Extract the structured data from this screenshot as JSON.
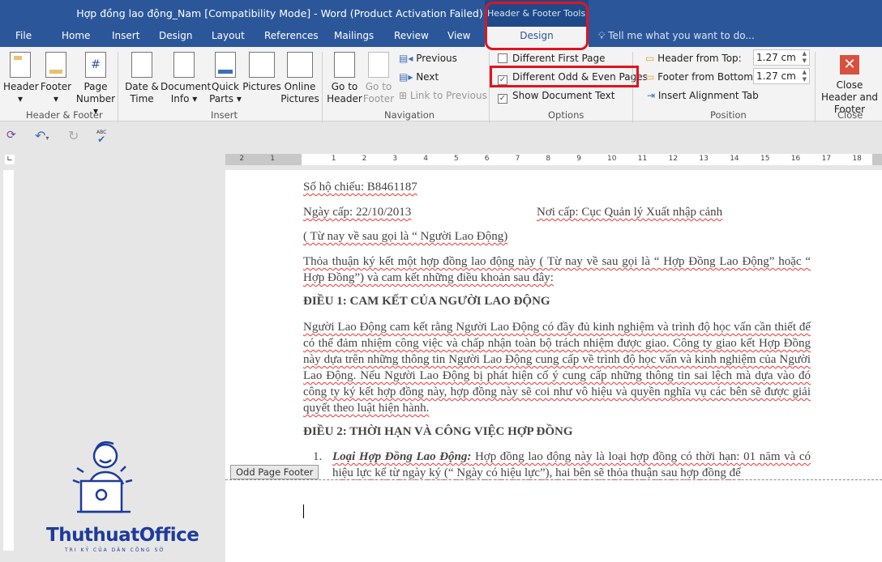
{
  "window": {
    "title": "Hợp đồng lao động_Nam [Compatibility Mode] - Word (Product Activation Failed)"
  },
  "tabs": [
    "File",
    "Home",
    "Insert",
    "Design",
    "Layout",
    "References",
    "Mailings",
    "Review",
    "View"
  ],
  "context_tab": {
    "group": "Header & Footer Tools",
    "label": "Design"
  },
  "tell_me": "Tell me what you want to do...",
  "ribbon": {
    "header_footer": {
      "label": "Header & Footer",
      "header": "Header",
      "footer": "Footer",
      "page_number": "Page Number"
    },
    "insert": {
      "label": "Insert",
      "date_time": "Date & Time",
      "doc_info": "Document Info",
      "quick_parts": "Quick Parts",
      "pictures": "Pictures",
      "online_pictures": "Online Pictures"
    },
    "navigation": {
      "label": "Navigation",
      "go_header": "Go to Header",
      "go_footer": "Go to Footer",
      "previous": "Previous",
      "next": "Next",
      "link_prev": "Link to Previous"
    },
    "options": {
      "label": "Options",
      "diff_first": "Different First Page",
      "diff_first_checked": false,
      "diff_odd_even": "Different Odd & Even Pages",
      "diff_odd_even_checked": true,
      "show_doc_text": "Show Document Text",
      "show_doc_text_checked": true
    },
    "position": {
      "label": "Position",
      "header_top": "Header from Top:",
      "header_top_value": "1.27 cm",
      "footer_bottom": "Footer from Bottom:",
      "footer_bottom_value": "1.27 cm",
      "align_tab": "Insert Alignment Tab"
    },
    "close": {
      "label": "Close",
      "close_btn": "Close Header and Footer"
    }
  },
  "ruler": {
    "labels": [
      "2",
      "1",
      "1",
      "2",
      "3",
      "4",
      "5",
      "6",
      "7",
      "8",
      "9",
      "10",
      "11",
      "12",
      "13",
      "14",
      "15",
      "16",
      "17",
      "18"
    ]
  },
  "document": {
    "passport": "Số hộ chiếu: B8461187",
    "issue_date": "Ngày cấp: 22/10/2013",
    "issue_place": "Nơi cấp: Cục Quản lý Xuất nhập cảnh",
    "hereafter": " ( Từ nay về sau gọi là “ Người Lao Động)",
    "agreement": "Thỏa thuận ký kết một hợp đồng lao động này ( Từ nay về sau gọi là “ Hợp Đồng Lao Động” hoặc “ Hợp Đồng”) và cam kết những điều khoản sau đây:",
    "article1": "ĐIỀU 1: CAM KẾT CỦA NGƯỜI LAO ĐỘNG",
    "article1_body": "Người Lao Động cam kết rằng Người Lao Động có đầy đủ kinh nghiệm và trình độ học vấn cần thiết để có thể đảm nhiệm công việc và chấp nhận toàn bộ trách nhiệm được giao. Công ty giao kết Hợp Đồng này dựa trên những thông tin Người Lao Động cung cấp về trình độ học vấn và kinh nghiệm của Người Lao Động. Nếu Người Lao Động bị phát hiện cố ý cung cấp những thông tin sai lệch mà dựa vào đó công ty ký kết hợp đồng này, hợp đồng này sẽ coi như vô hiệu và quyền nghĩa vụ các bên sẽ được giải quyết theo luật hiện hành.",
    "article2": "ĐIỀU 2: THỜI HẠN VÀ CÔNG VIỆC HỢP ĐỒNG",
    "item1_num": "1.",
    "item1_title": "Loại Hợp Đồng Lao Động:",
    "item1_body": " Hợp đồng lao động này là loại hợp đồng có thời hạn: 01 năm và có hiệu lực kể từ ngày ký (“ Ngày có hiệu lực”), hai bên sẽ thỏa thuận sau hợp đồng để",
    "footer_tag": "Odd Page Footer"
  },
  "watermark": {
    "brand": "ThuthuatOffice",
    "tagline": "TRI KỶ CỦA DÂN CÔNG SỞ"
  },
  "colors": {
    "brand": "#2b579a",
    "highlight": "#e0141e",
    "close": "#d9503f"
  }
}
